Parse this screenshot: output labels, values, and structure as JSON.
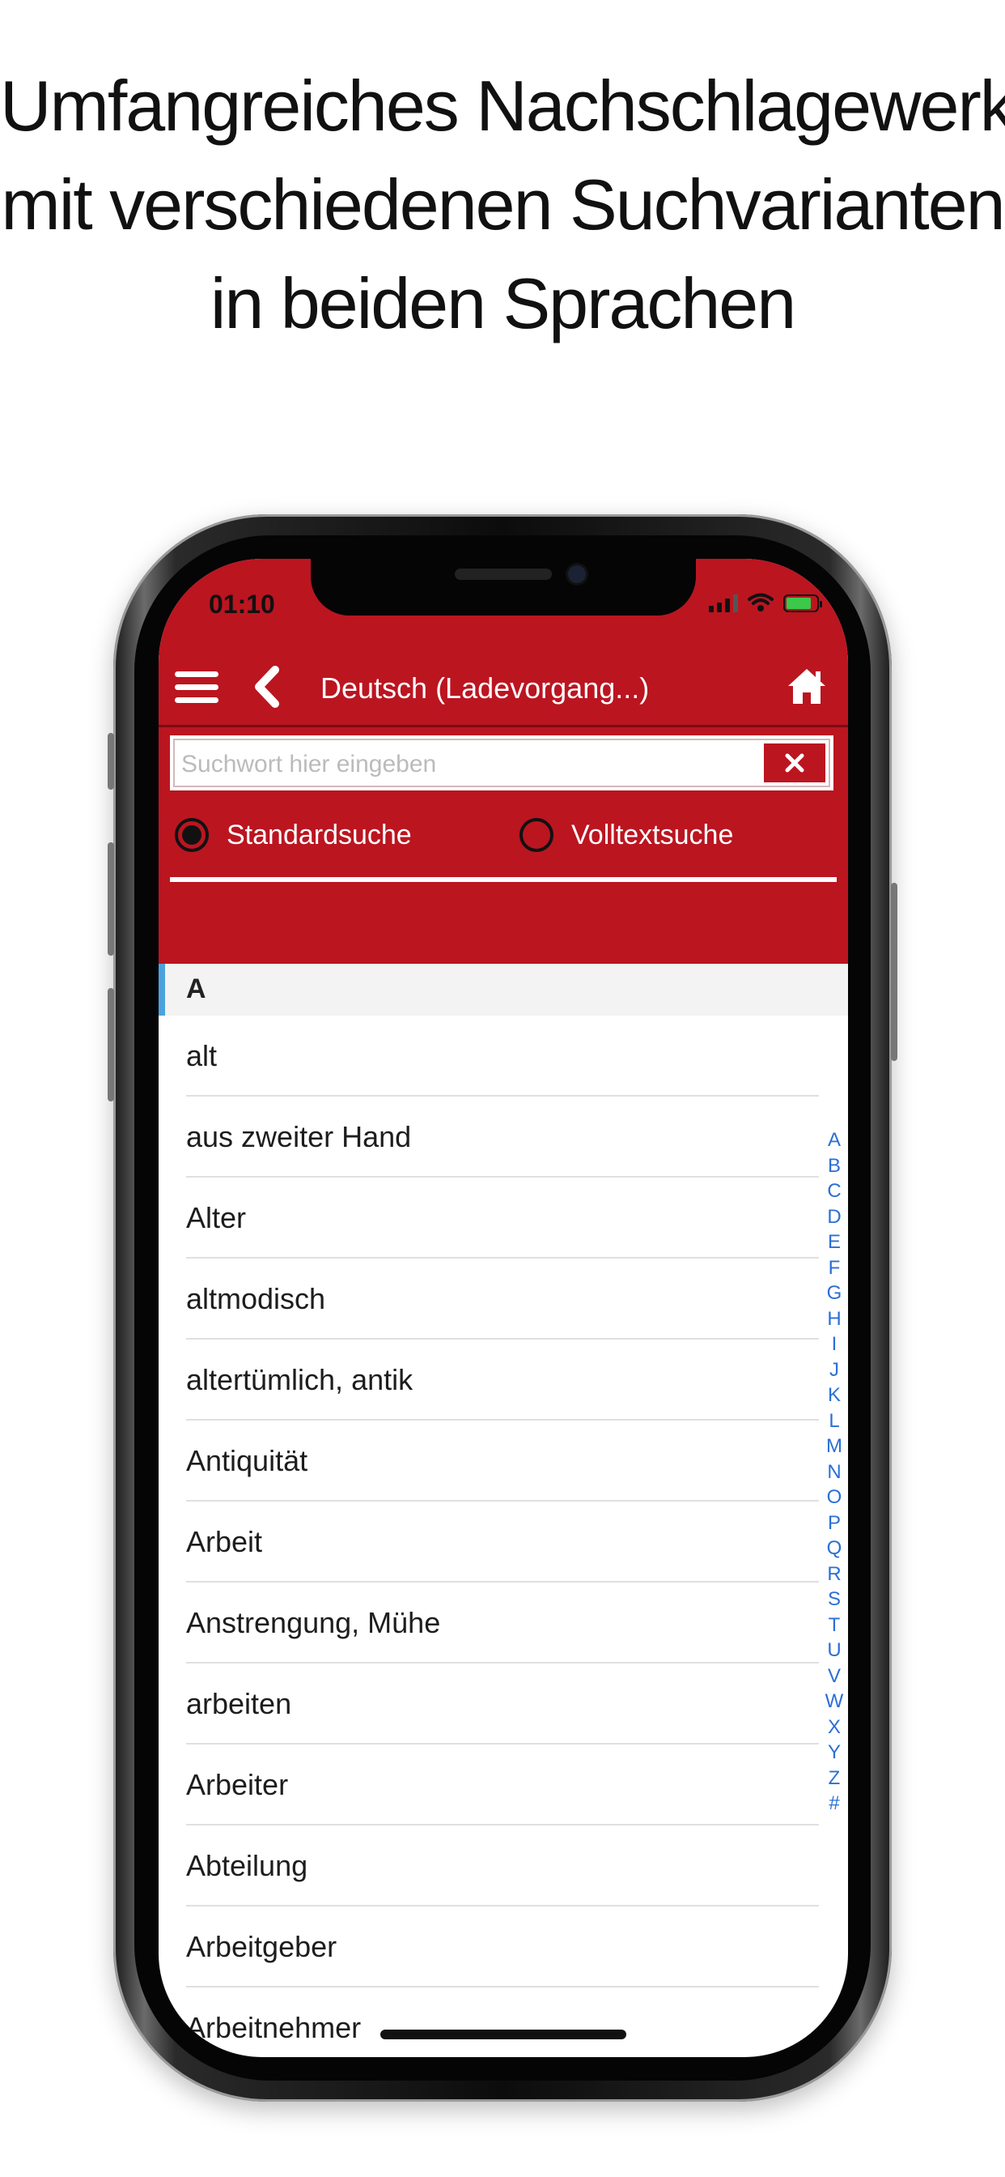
{
  "headline": {
    "line1": "Umfangreiches Nachschlagewerk",
    "line2": "mit verschiedenen Suchvarianten",
    "line3": "in beiden Sprachen"
  },
  "status_bar": {
    "time": "01:10"
  },
  "nav": {
    "title": "Deutsch (Ladevorgang...)",
    "menu_icon": "hamburger-menu-icon",
    "back_icon": "chevron-left-icon",
    "home_icon": "home-icon"
  },
  "search": {
    "placeholder": "Suchwort hier eingeben",
    "value": ""
  },
  "search_modes": [
    {
      "label": "Standardsuche",
      "selected": true
    },
    {
      "label": "Volltextsuche",
      "selected": false
    }
  ],
  "section": {
    "letter": "A"
  },
  "entries": [
    "alt",
    "aus zweiter Hand",
    "Alter",
    "altmodisch",
    "altertümlich, antik",
    "Antiquität",
    "Arbeit",
    "Anstrengung, Mühe",
    "arbeiten",
    "Arbeiter",
    "Abteilung",
    "Arbeitgeber",
    "Arbeitnehmer"
  ],
  "alpha_index": [
    "A",
    "B",
    "C",
    "D",
    "E",
    "F",
    "G",
    "H",
    "I",
    "J",
    "K",
    "L",
    "M",
    "N",
    "O",
    "P",
    "Q",
    "R",
    "S",
    "T",
    "U",
    "V",
    "W",
    "X",
    "Y",
    "Z",
    "#"
  ],
  "colors": {
    "brand_red": "#bb1520",
    "index_blue": "#2a6fd6",
    "section_accent": "#4aa3df"
  }
}
